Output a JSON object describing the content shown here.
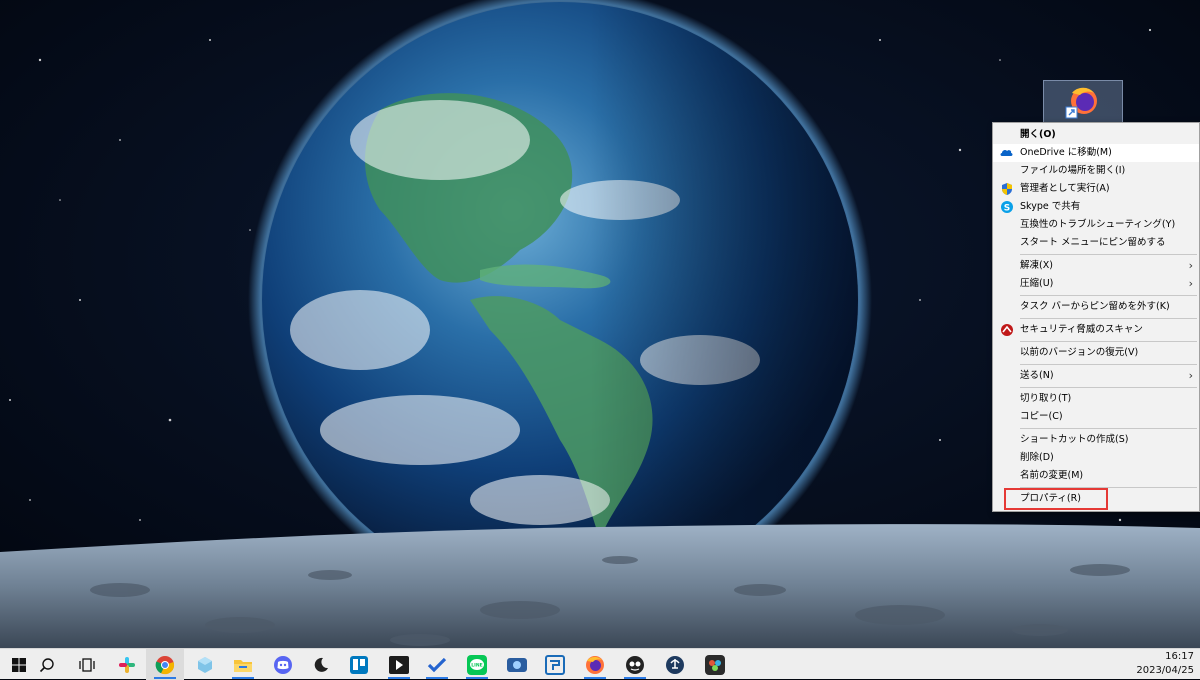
{
  "desktop": {
    "shortcut_icon": "firefox-shortcut-icon"
  },
  "context_menu": {
    "items": [
      {
        "label": "開く(O)",
        "bold": true
      },
      {
        "label": "OneDrive に移動(M)",
        "icon": "onedrive-icon"
      },
      {
        "label": "ファイルの場所を開く(I)"
      },
      {
        "label": "管理者として実行(A)",
        "icon": "uac-shield-icon"
      },
      {
        "label": "Skype で共有",
        "icon": "skype-icon"
      },
      {
        "label": "互換性のトラブルシューティング(Y)"
      },
      {
        "label": "スタート メニューにピン留めする"
      },
      {
        "label": "解凍(X)",
        "submenu": true
      },
      {
        "label": "圧縮(U)",
        "submenu": true
      },
      {
        "label": "タスク バーからピン留めを外す(K)"
      },
      {
        "label": "セキュリティ脅威のスキャン",
        "icon": "mcafee-icon"
      },
      {
        "label": "以前のバージョンの復元(V)"
      },
      {
        "label": "送る(N)",
        "submenu": true
      },
      {
        "label": "切り取り(T)"
      },
      {
        "label": "コピー(C)"
      },
      {
        "label": "ショートカットの作成(S)"
      },
      {
        "label": "削除(D)"
      },
      {
        "label": "名前の変更(M)"
      },
      {
        "label": "プロパティ(R)",
        "highlighted": true
      }
    ],
    "highlight_color": "#e53935"
  },
  "taskbar": {
    "items": [
      "windows-start-icon",
      "search-icon",
      "task-view-icon",
      "slack-icon",
      "chrome-icon",
      "box-drive-icon",
      "file-explorer-icon",
      "discord-icon",
      "moon-app-icon",
      "trello-icon",
      "media-player-icon",
      "todo-check-icon",
      "line-icon",
      "camera-app-icon",
      "remote-app-icon",
      "firefox-icon",
      "game-app-icon",
      "audio-app-icon",
      "davinci-resolve-icon"
    ],
    "clock": {
      "time": "16:17",
      "date": "2023/04/25"
    },
    "accent": "#2c7be5"
  }
}
